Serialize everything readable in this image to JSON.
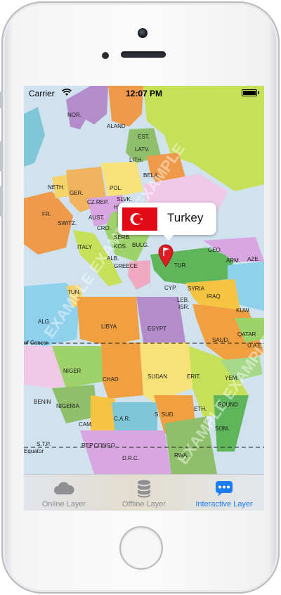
{
  "status_bar": {
    "carrier": "Carrier",
    "time": "12:07 PM"
  },
  "callout": {
    "title": "Turkey",
    "flag_icon": "turkey-flag-icon"
  },
  "map": {
    "watermark": "EXAMPLE EXAMPLE EXAMPLE",
    "labels": [
      "NOR.",
      "ALAND",
      "EST.",
      "LATV.",
      "LITH.",
      "BELA.",
      "NETH.",
      "GER.",
      "POL.",
      "FR.",
      "CZ.REP.",
      "AUST.",
      "HUN.",
      "SLVK.",
      "SWITZ.",
      "CRO.",
      "SERB.",
      "ITALY",
      "KOS.",
      "BULG.",
      "ALB.",
      "GREECE",
      "TUR.",
      "GEO.",
      "AZE.",
      "ARM.",
      "CYP.",
      "SYRIA",
      "IRAQ",
      "TUN.",
      "LEB.",
      "ISR.",
      "KUW.",
      "ALG.",
      "LIBYA",
      "EGYPT",
      "SAUD.",
      "QATAR",
      "U.A.E.",
      "of Cancer",
      "NIGER",
      "CHAD",
      "SUDAN",
      "ERIT.",
      "YEM.",
      "BENIN",
      "NIGERIA",
      "ETH.",
      "SOUND",
      "CAM.",
      "C.A.R.",
      "S. SUD.",
      "SOM.",
      "REP.CONGO",
      "S.T.P.",
      "Equator",
      "D.R.C.",
      "RWA."
    ]
  },
  "tabs": [
    {
      "label": "Online Layer",
      "icon": "cloud-icon",
      "active": false
    },
    {
      "label": "Offline Layer",
      "icon": "database-icon",
      "active": false
    },
    {
      "label": "Interactive Layer",
      "icon": "chat-bubble-icon",
      "active": true
    }
  ],
  "colors": {
    "accent": "#1a7cf3",
    "inactive": "#8e8e93",
    "flag_red": "#e30a17",
    "pin_red": "#e01a22",
    "sea": "#cfe2ee"
  }
}
